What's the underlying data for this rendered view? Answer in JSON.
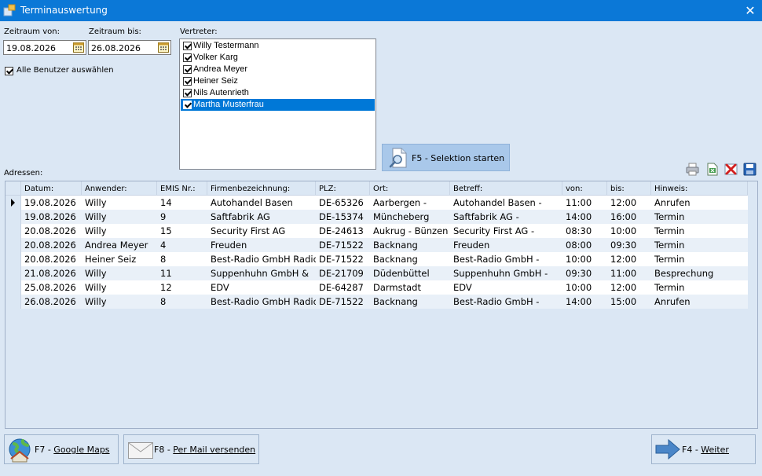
{
  "window": {
    "title": "Terminauswertung"
  },
  "filters": {
    "from_label": "Zeitraum von:",
    "from_value": "19.08.2026",
    "to_label": "Zeitraum bis:",
    "to_value": "26.08.2026",
    "all_users_label": "Alle Benutzer auswählen",
    "all_users_checked": true
  },
  "vertreter": {
    "label": "Vertreter:",
    "items": [
      {
        "name": "Willy Testermann",
        "checked": true
      },
      {
        "name": "Volker Karg",
        "checked": true
      },
      {
        "name": "Andrea Meyer",
        "checked": true
      },
      {
        "name": "Heiner Seiz",
        "checked": true
      },
      {
        "name": "Nils Autenrieth",
        "checked": true
      },
      {
        "name": "Martha Musterfrau",
        "checked": true,
        "selected": true
      }
    ]
  },
  "selection_button": {
    "label": "F5 - Selektion starten"
  },
  "addresses": {
    "label": "Adressen:",
    "columns": [
      "Datum:",
      "Anwender:",
      "EMIS Nr.:",
      "Firmenbezeichnung:",
      "PLZ:",
      "Ort:",
      "Betreff:",
      "von:",
      "bis:",
      "Hinweis:"
    ],
    "rows": [
      [
        "19.08.2026",
        "Willy",
        "14",
        "Autohandel Basen",
        "DE-65326",
        "Aarbergen -",
        "Autohandel Basen -",
        "11:00",
        "12:00",
        "Anrufen"
      ],
      [
        "19.08.2026",
        "Willy",
        "9",
        "Saftfabrik AG",
        "DE-15374",
        "Müncheberg",
        "Saftfabrik AG -",
        "14:00",
        "16:00",
        "Termin"
      ],
      [
        "20.08.2026",
        "Willy",
        "15",
        "Security First AG",
        "DE-24613",
        "Aukrug - Bünzen",
        "Security First AG -",
        "08:30",
        "10:00",
        "Termin"
      ],
      [
        "20.08.2026",
        "Andrea Meyer",
        "4",
        "Freuden",
        "DE-71522",
        "Backnang",
        "Freuden",
        "08:00",
        "09:30",
        "Termin"
      ],
      [
        "20.08.2026",
        "Heiner Seiz",
        "8",
        "Best-Radio GmbH Radio",
        "DE-71522",
        "Backnang",
        "Best-Radio GmbH -",
        "10:00",
        "12:00",
        "Termin"
      ],
      [
        "21.08.2026",
        "Willy",
        "11",
        "Suppenhuhn GmbH &",
        "DE-21709",
        "Düdenbüttel",
        "Suppenhuhn GmbH -",
        "09:30",
        "11:00",
        "Besprechung"
      ],
      [
        "25.08.2026",
        "Willy",
        "12",
        "EDV",
        "DE-64287",
        "Darmstadt",
        "EDV",
        "10:00",
        "12:00",
        "Termin"
      ],
      [
        "26.08.2026",
        "Willy",
        "8",
        "Best-Radio GmbH Radio",
        "DE-71522",
        "Backnang",
        "Best-Radio GmbH -",
        "14:00",
        "15:00",
        "Anrufen"
      ]
    ],
    "current_row": 0
  },
  "toolbar": {
    "icons": [
      "printer-icon",
      "export-icon",
      "delete-icon",
      "save-icon"
    ]
  },
  "buttons": {
    "maps": {
      "key": "F7 - ",
      "label": "Google Maps"
    },
    "mail": {
      "key": "F8 - ",
      "label": "Per Mail versenden"
    },
    "next": {
      "key": "F4 - ",
      "label": "Weiter"
    }
  },
  "colors": {
    "titlebar": "#0b78d7",
    "selection": "#0078d7",
    "background": "#dbe7f4"
  }
}
